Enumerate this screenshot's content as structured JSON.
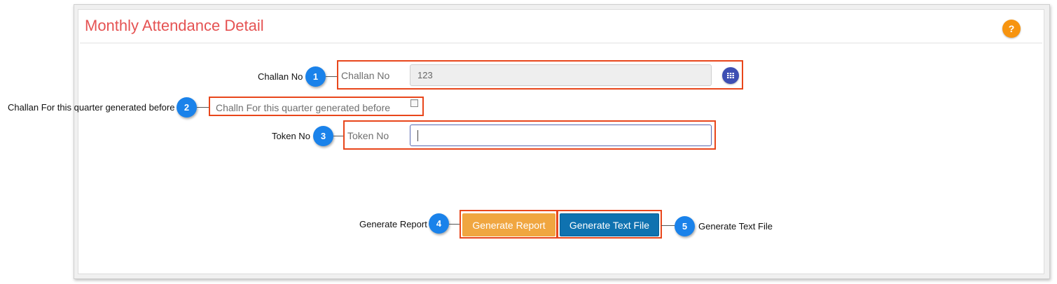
{
  "header": {
    "title": "Monthly Attendance Detail",
    "help_glyph": "?"
  },
  "colors": {
    "title": "#e55353",
    "highlight": "#e8461b",
    "badge": "#1a82ea",
    "orange_button": "#f0a640",
    "blue_button": "#0f72b0",
    "help": "#f7940f"
  },
  "form": {
    "challan_no": {
      "label": "Challan No",
      "value": "123",
      "lookup_icon": "grid-list-icon"
    },
    "generated_before": {
      "label": "Challn For this quarter generated before",
      "checked": false
    },
    "token_no": {
      "label": "Token No",
      "value": ""
    }
  },
  "buttons": {
    "generate_report": "Generate Report",
    "generate_text_file": "Generate Text File"
  },
  "annotations": [
    {
      "num": "1",
      "text": "Challan No"
    },
    {
      "num": "2",
      "text": "Challan For this quarter generated before"
    },
    {
      "num": "3",
      "text": "Token No"
    },
    {
      "num": "4",
      "text": "Generate Report"
    },
    {
      "num": "5",
      "text": "Generate Text File"
    }
  ]
}
